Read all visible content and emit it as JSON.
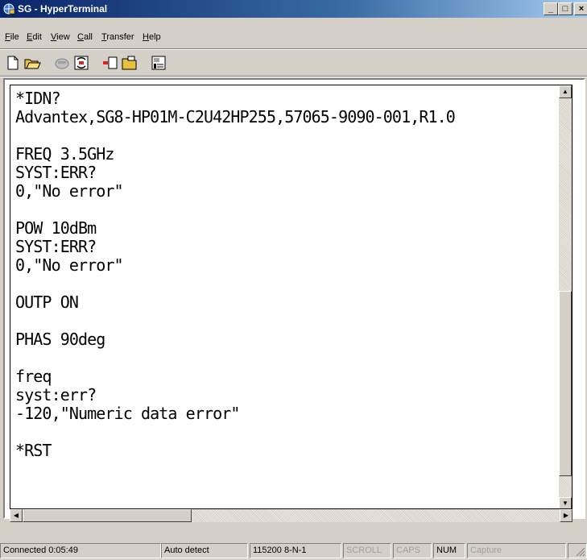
{
  "window": {
    "title": "SG - HyperTerminal",
    "minimize_glyph": "_",
    "maximize_glyph": "□",
    "close_glyph": "×"
  },
  "menu": {
    "items": [
      {
        "label": "File",
        "mnemonic": "F"
      },
      {
        "label": "Edit",
        "mnemonic": "E"
      },
      {
        "label": "View",
        "mnemonic": "V"
      },
      {
        "label": "Call",
        "mnemonic": "C"
      },
      {
        "label": "Transfer",
        "mnemonic": "T"
      },
      {
        "label": "Help",
        "mnemonic": "H"
      }
    ]
  },
  "toolbar": {
    "buttons": [
      "new-icon",
      "open-icon",
      "disconnect-icon",
      "dial-icon",
      "send-icon",
      "receive-icon",
      "properties-icon"
    ]
  },
  "terminal": {
    "lines": [
      "*IDN?",
      "Advantex,SG8-HP01M-C2U42HP255,57065-9090-001,R1.0",
      "",
      "FREQ 3.5GHz",
      "SYST:ERR?",
      "0,\"No error\"",
      "",
      "POW 10dBm",
      "SYST:ERR?",
      "0,\"No error\"",
      "",
      "OUTP ON",
      "",
      "PHAS 90deg",
      "",
      "freq",
      "syst:err?",
      "-120,\"Numeric data error\"",
      "",
      "*RST"
    ]
  },
  "statusbar": {
    "connected": "Connected 0:05:49",
    "detect": "Auto detect",
    "settings": "115200 8-N-1",
    "scroll": "SCROLL",
    "caps": "CAPS",
    "num": "NUM",
    "capture": "Capture"
  },
  "colors": {
    "title_start": "#0a246a",
    "title_end": "#a6caf0",
    "chrome": "#d4d0c8",
    "terminal_bg": "#ffffff"
  }
}
